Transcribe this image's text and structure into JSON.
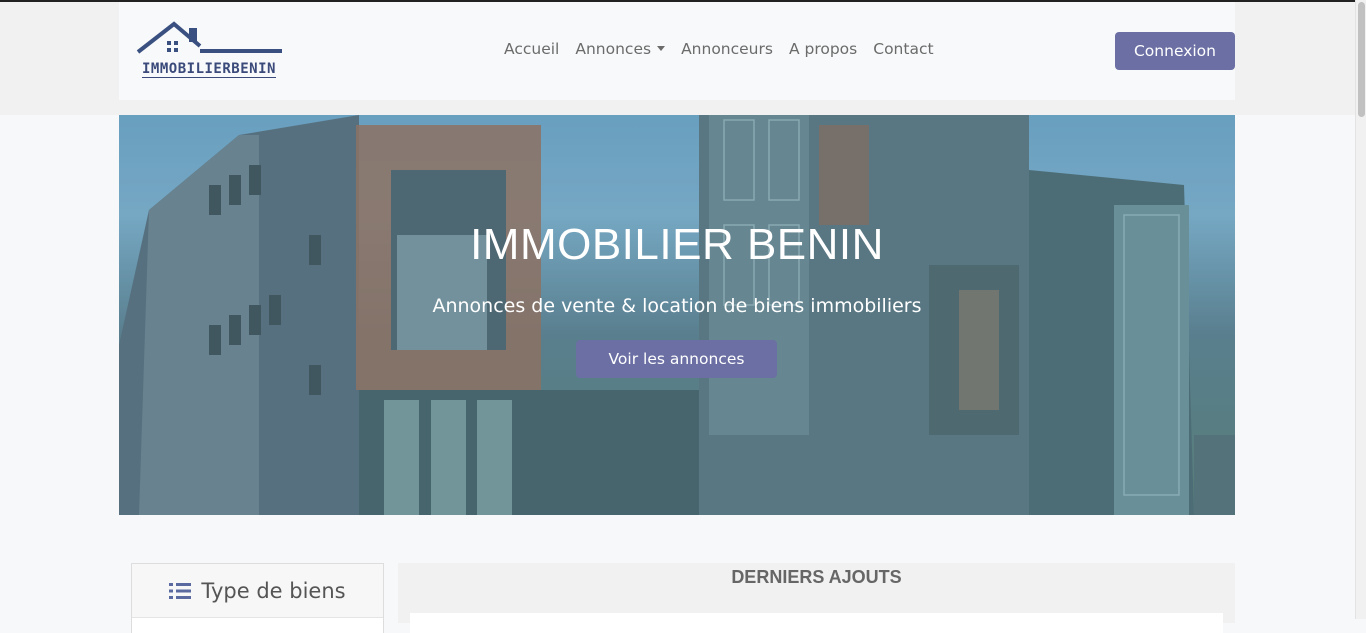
{
  "brand": {
    "logo_text": "IMMOBILIERBENIN",
    "logo_icon": "house-roof-icon",
    "color": "#3a4a7a"
  },
  "nav": {
    "items": [
      {
        "label": "Accueil"
      },
      {
        "label": "Annonces",
        "dropdown": true
      },
      {
        "label": "Annonceurs"
      },
      {
        "label": "A propos"
      },
      {
        "label": "Contact"
      }
    ],
    "login_label": "Connexion",
    "accent": "#6b6fa3"
  },
  "hero": {
    "title": "IMMOBILIER BENIN",
    "subtitle": "Annonces de vente & location de biens immobiliers",
    "cta_label": "Voir les annonces"
  },
  "sidebar": {
    "heading": "Type de biens",
    "icon": "list-icon"
  },
  "recent": {
    "heading": "DERNIERS AJOUTS"
  }
}
